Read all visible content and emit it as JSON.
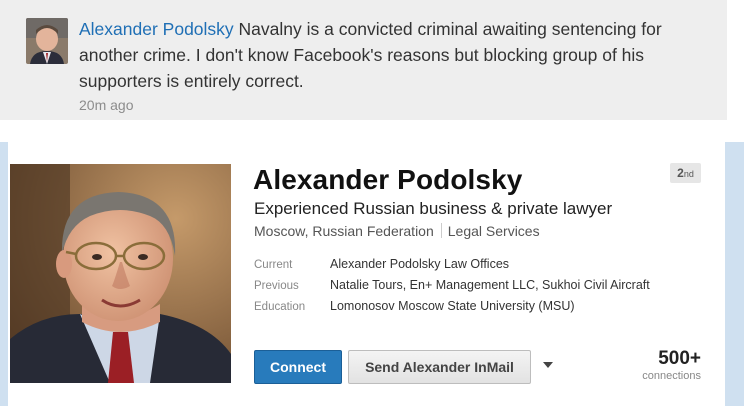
{
  "comment": {
    "author": "Alexander Podolsky",
    "text": "Navalny is a convicted criminal awaiting sentencing for another crime. I don't know Facebook's reasons but blocking group of his supporters is entirely correct.",
    "time": "20m ago"
  },
  "profile": {
    "name": "Alexander Podolsky",
    "degree_number": "2",
    "degree_suffix": "nd",
    "headline": "Experienced Russian business & private lawyer",
    "location": "Moscow, Russian Federation",
    "industry": "Legal Services",
    "facts": [
      {
        "label": "Current",
        "value": "Alexander Podolsky Law Offices"
      },
      {
        "label": "Previous",
        "value": "Natalie Tours, En+ Management LLC, Sukhoi Civil Aircraft"
      },
      {
        "label": "Education",
        "value": "Lomonosov Moscow State University (MSU)"
      }
    ],
    "connect_label": "Connect",
    "inmail_label": "Send Alexander InMail",
    "connections_count": "500+",
    "connections_label": "connections"
  },
  "colors": {
    "link": "#1f6fb5",
    "connect_button": "#287bbc",
    "comment_bg": "#eeeeee",
    "side_strip": "#cfe0f0"
  },
  "icons": {
    "dropdown": "caret-down-icon"
  }
}
